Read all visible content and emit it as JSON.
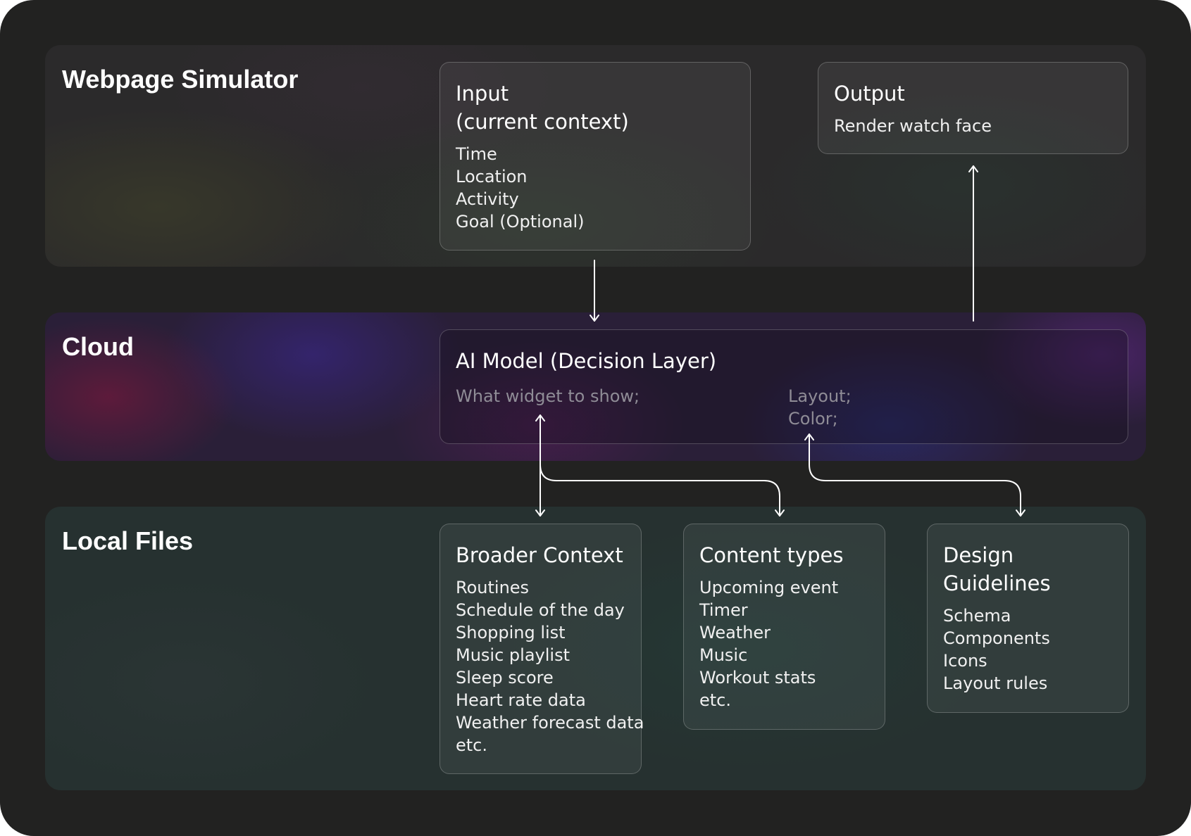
{
  "layers": {
    "web": {
      "title": "Webpage Simulator"
    },
    "cloud": {
      "title": "Cloud"
    },
    "local": {
      "title": "Local Files"
    }
  },
  "cards": {
    "input": {
      "title": "Input\n(current context)",
      "items": [
        "Time",
        "Location",
        "Activity",
        "Goal (Optional)"
      ]
    },
    "output": {
      "title": "Output",
      "items": [
        "Render watch face"
      ]
    },
    "ai_model": {
      "title": "AI Model (Decision Layer)",
      "left_items": [
        "What widget to show;"
      ],
      "right_items": [
        "Layout;",
        "Color;"
      ]
    },
    "broader_context": {
      "title": "Broader Context",
      "items": [
        "Routines",
        "Schedule of the day",
        "Shopping list",
        "Music playlist",
        "Sleep score",
        "Heart rate data",
        "Weather forecast data",
        "etc."
      ]
    },
    "content_types": {
      "title": "Content types",
      "items": [
        "Upcoming event",
        "Timer",
        "Weather",
        "Music",
        "Workout stats",
        "etc."
      ]
    },
    "design_guidelines": {
      "title": "Design\nGuidelines",
      "items": [
        "Schema",
        "Components",
        "Icons",
        "Layout rules"
      ]
    }
  },
  "colors": {
    "frame": "#222221",
    "text": "#ffffff",
    "muted_text": "#8f8c96",
    "arrow": "#ffffff"
  }
}
